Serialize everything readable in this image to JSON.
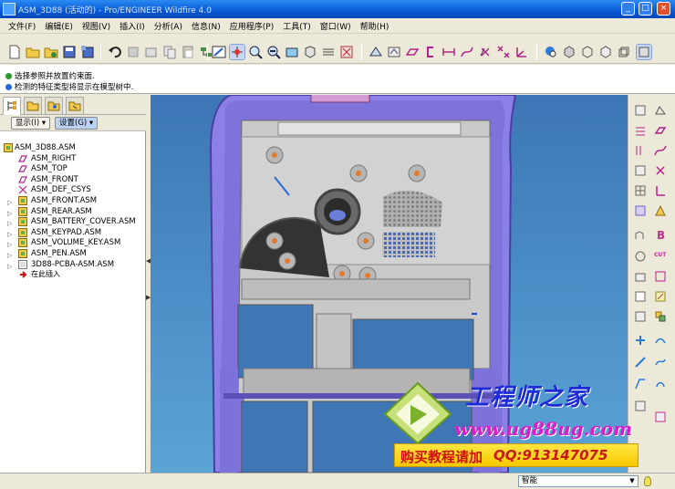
{
  "window": {
    "title": "ASM_3D88 (活动的) - Pro/ENGINEER Wildfire 4.0",
    "controls": [
      "_",
      "□",
      "×"
    ]
  },
  "menu": [
    "文件(F)",
    "编辑(E)",
    "视图(V)",
    "插入(I)",
    "分析(A)",
    "信息(N)",
    "应用程序(P)",
    "工具(T)",
    "窗口(W)",
    "帮助(H)"
  ],
  "messages": [
    {
      "icon": "info-icon",
      "color": "#2a9a2a",
      "text": "选择参照并放置约束面."
    },
    {
      "icon": "info-icon",
      "color": "#2a6ad8",
      "text": "检测的特征类型将显示在模型树中."
    }
  ],
  "navigator": {
    "show_button": "显示(I) ▾",
    "settings_button": "设置(G) ▾",
    "tree": [
      {
        "label": "ASM_3D88.ASM",
        "type": "assembly",
        "expandable": false,
        "indent": 0
      },
      {
        "label": "ASM_RIGHT",
        "type": "datum-plane",
        "expandable": false,
        "indent": 1
      },
      {
        "label": "ASM_TOP",
        "type": "datum-plane",
        "expandable": false,
        "indent": 1
      },
      {
        "label": "ASM_FRONT",
        "type": "datum-plane",
        "expandable": false,
        "indent": 1
      },
      {
        "label": "ASM_DEF_CSYS",
        "type": "csys",
        "expandable": false,
        "indent": 1
      },
      {
        "label": "ASM_FRONT.ASM",
        "type": "assembly",
        "expandable": true,
        "indent": 1
      },
      {
        "label": "ASM_REAR.ASM",
        "type": "assembly",
        "expandable": true,
        "indent": 1
      },
      {
        "label": "ASM_BATTERY_COVER.ASM",
        "type": "assembly",
        "expandable": true,
        "indent": 1
      },
      {
        "label": "ASM_KEYPAD.ASM",
        "type": "assembly",
        "expandable": true,
        "indent": 1
      },
      {
        "label": "ASM_VOLUME_KEY.ASM",
        "type": "assembly",
        "expandable": true,
        "indent": 1
      },
      {
        "label": "ASM_PEN.ASM",
        "type": "assembly",
        "expandable": true,
        "indent": 1
      },
      {
        "label": "3D88-PCBA-ASM.ASM",
        "type": "part",
        "expandable": true,
        "indent": 1
      },
      {
        "label": "在此插入",
        "type": "insert-here",
        "expandable": false,
        "indent": 1
      }
    ]
  },
  "status": {
    "filter_value": "智能"
  },
  "watermark": {
    "title": "工程师之家",
    "url": "www.ug88ug.com",
    "banner_text": "购买教程请加",
    "banner_qq": "QQ:913147075"
  },
  "right_toolbar_labels": {
    "cut": "CUT"
  },
  "colors": {
    "viewport_bg_top": "#3f79b8",
    "viewport_bg_bottom": "#5aa8d8",
    "model_frame": "#8c82e8",
    "model_body": "#c8c8c8",
    "accent_orange": "#e07a30",
    "titlebar": "#0a5bd8"
  }
}
